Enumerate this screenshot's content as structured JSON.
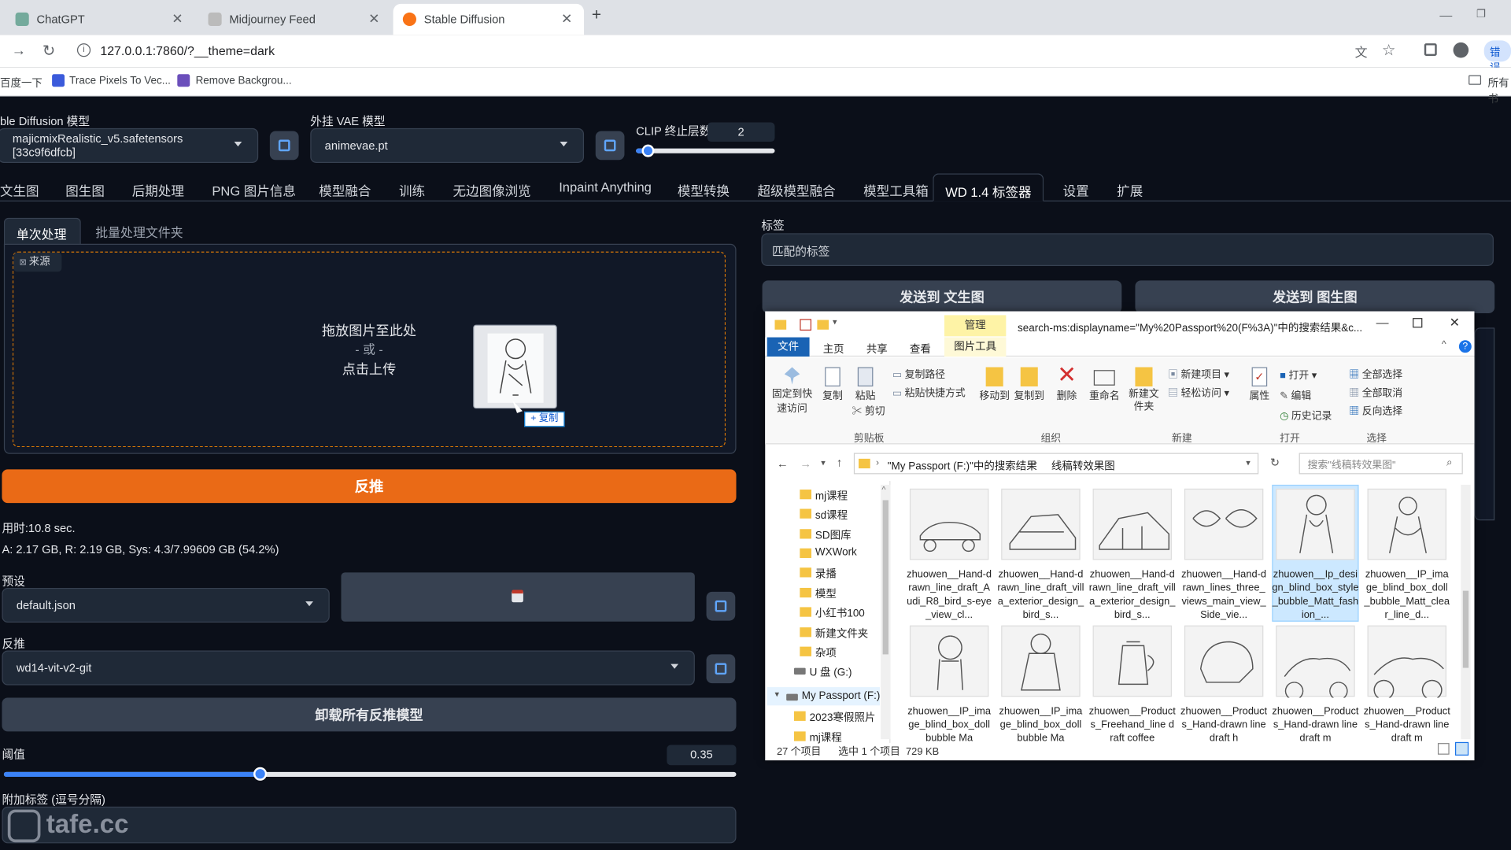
{
  "browser": {
    "tabs": [
      {
        "label": "ChatGPT"
      },
      {
        "label": "Midjourney Feed"
      },
      {
        "label": "Stable Diffusion"
      }
    ],
    "url": "127.0.0.1:7860/?__theme=dark",
    "bookmarks": [
      "百度一下",
      "Trace Pixels To Vec...",
      "Remove Backgrou..."
    ],
    "bookmark_right": "所有书",
    "profile_text": "错误"
  },
  "sd": {
    "model_label": "ble Diffusion 模型",
    "model_value": "majicmixRealistic_v5.safetensors [33c9f6dfcb]",
    "vae_label": "外挂 VAE 模型",
    "vae_value": "animevae.pt",
    "clip_label": "CLIP 终止层数",
    "clip_value": "2",
    "clip_level": 0.08,
    "main_tabs": [
      "文生图",
      "图生图",
      "后期处理",
      "PNG 图片信息",
      "模型融合",
      "训练",
      "无边图像浏览",
      "Inpaint Anything",
      "模型转换",
      "超级模型融合",
      "模型工具箱",
      "WD 1.4 标签器",
      "设置",
      "扩展"
    ],
    "active_tab": "WD 1.4 标签器",
    "sub_tabs": [
      "单次处理",
      "批量处理文件夹"
    ],
    "source_label": "来源",
    "drop_line1": "拖放图片至此处",
    "drop_or": "- 或 -",
    "drop_line2": "点击上传",
    "copy_badge": "+ 复制",
    "interrogate_button": "反推",
    "time_text": "用时:10.8 sec.",
    "mem_text": "A: 2.17 GB, R: 2.19 GB, Sys: 4.3/7.99609 GB (54.2%)",
    "preset_label": "预设",
    "preset_value": "default.json",
    "interrogator_label": "反推",
    "interrogator_value": "wd14-vit-v2-git",
    "unload_button": "卸载所有反推模型",
    "threshold_label": "阈值",
    "threshold_value": "0.35",
    "extra_tags_label": "附加标签 (逗号分隔)",
    "watermark": "tafe.cc",
    "tags_label": "标签",
    "matched_tags_placeholder": "匹配的标签",
    "send_txt2img": "发送到 文生图",
    "send_img2img": "发送到 图生图"
  },
  "explorer": {
    "title": "search-ms:displayname=\"My%20Passport%20(F%3A)\"中的搜索结果&c...",
    "context_tab": "管理",
    "ribbon_tabs": [
      "文件",
      "主页",
      "共享",
      "查看",
      "图片工具"
    ],
    "ribbon_items": {
      "pin": "固定到快速访问",
      "copy": "复制",
      "paste": "粘贴",
      "copy_path": "复制路径",
      "paste_shortcut": "粘贴快捷方式",
      "cut": "剪切",
      "move_to": "移动到",
      "copy_to": "复制到",
      "delete": "删除",
      "rename": "重命名",
      "new_folder": "新建文件夹",
      "new_item": "新建项目",
      "easy_access": "轻松访问",
      "properties": "属性",
      "open": "打开",
      "edit": "编辑",
      "history": "历史记录",
      "select_all": "全部选择",
      "select_none": "全部取消",
      "invert": "反向选择"
    },
    "groups": [
      "剪贴板",
      "组织",
      "新建",
      "打开",
      "选择"
    ],
    "breadcrumb": [
      "\"My Passport (F:)\"中的搜索结果",
      "线稿转效果图"
    ],
    "search_placeholder": "搜索\"线稿转效果图\"",
    "tree": [
      "mj课程",
      "sd课程",
      "SD图库",
      "WXWork",
      "录播",
      "模型",
      "小红书100",
      "新建文件夹",
      "杂项",
      "U 盘 (G:)",
      "My Passport (F:)",
      "2023寒假照片",
      "mj课程"
    ],
    "files": [
      "zhuowen__Hand-drawn_line_draft_Audi_R8_bird_s-eye_view_cl...",
      "zhuowen__Hand-drawn_line_draft_villa_exterior_design_bird_s...",
      "zhuowen__Hand-drawn_line_draft_villa_exterior_design_bird_s...",
      "zhuowen__Hand-drawn_lines_three_views_main_view_Side_vie...",
      "zhuowen__Ip_design_blind_box_style_bubble_Matt_fashion_...",
      "zhuowen__IP_image_blind_box_doll_bubble_Matt_clear_line_d...",
      "zhuowen__IP_image_blind_box_doll bubble Ma",
      "zhuowen__IP_image_blind_box_doll bubble Ma",
      "zhuowen__Products_Freehand_line draft coffee",
      "zhuowen__Products_Hand-drawn line draft h",
      "zhuowen__Products_Hand-drawn line draft m",
      "zhuowen__Products_Hand-drawn line draft m"
    ],
    "status_count": "27 个项目",
    "status_selected": "选中 1 个项目  729 KB"
  }
}
